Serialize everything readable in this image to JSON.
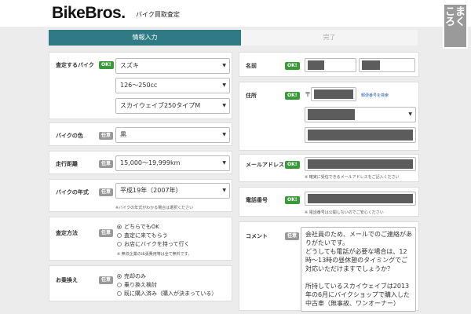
{
  "brand": {
    "logo": "BikeBros.",
    "subtitle": "バイク買取査定"
  },
  "corner_badge": {
    "chars": [
      "こ",
      "ま",
      "ろ",
      "く"
    ]
  },
  "steps": {
    "current": "情報入力",
    "next": "完了"
  },
  "tags": {
    "required": "OK!",
    "optional": "任意"
  },
  "form_left": {
    "bike": {
      "label": "査定するバイク",
      "maker": "スズキ",
      "displacement": "126～250cc",
      "model": "スカイウェイブ250タイプM"
    },
    "color": {
      "label": "バイクの色",
      "value": "黒"
    },
    "mileage": {
      "label": "走行距離",
      "value": "15,000～19,999km"
    },
    "year": {
      "label": "バイクの年式",
      "value": "平成19年（2007年）",
      "note": "※バイクの年式がわかる場合は選択ください"
    },
    "method": {
      "label": "査定方法",
      "options": [
        "どちらでもOK",
        "査定に来てもらう",
        "お店にバイクを持って行く"
      ],
      "selected_index": 0,
      "note": "※ 無収企業の出張費用等は全て無料です。"
    },
    "replace": {
      "label": "お乗換え",
      "options": [
        "売却のみ",
        "乗り換え検討",
        "既に購入済み（購入が決まっている）"
      ],
      "selected_index": 0
    }
  },
  "form_right": {
    "name": {
      "label": "名前"
    },
    "address": {
      "label": "住所",
      "postal_mark": "〒",
      "postal_search": "郵便番号を検索"
    },
    "email": {
      "label": "メールアドレス",
      "note": "※ 確実に受信できるメールアドレスをご記入ください"
    },
    "phone": {
      "label": "電話番号",
      "note": "※ 電話番号は公開しないのでご安心ください"
    },
    "comment": {
      "label": "コメント",
      "lines": [
        "会社員のため、メールでのご連絡があ",
        "りがたいです。",
        "どうしても電話が必要な場合は、12",
        "時～13時の昼休憩のタイミングでご",
        "対応いただけますでしょうか？",
        "",
        "所持しているスカイウェイブは2013",
        "年の6月にバイクショップで購入した",
        "中古車（無事故、ワンオーナー）"
      ]
    }
  }
}
